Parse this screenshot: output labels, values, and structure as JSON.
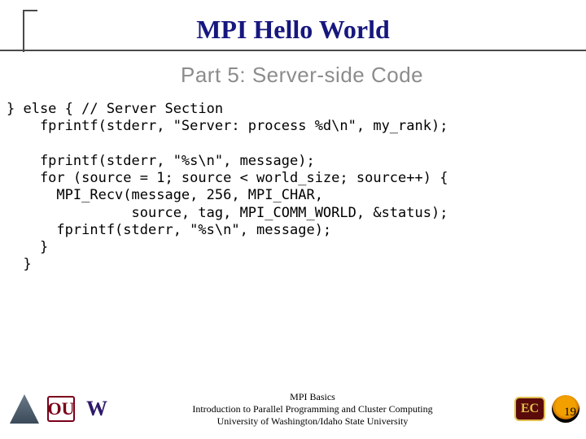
{
  "header": {
    "title": "MPI Hello World",
    "subtitle": "Part 5: Server-side Code"
  },
  "code": "} else { // Server Section\n    fprintf(stderr, \"Server: process %d\\n\", my_rank);\n\n    fprintf(stderr, \"%s\\n\", message);\n    for (source = 1; source < world_size; source++) {\n      MPI_Recv(message, 256, MPI_CHAR,\n               source, tag, MPI_COMM_WORLD, &status);\n      fprintf(stderr, \"%s\\n\", message);\n    }\n  }",
  "footer": {
    "line1": "MPI Basics",
    "line2": "Introduction to Parallel Programming and Cluster Computing",
    "line3": "University of Washington/Idaho State University"
  },
  "logos": {
    "tri": "",
    "ou": "OU",
    "w": "W",
    "ec": "EC",
    "tiger": ""
  },
  "page_number": "19"
}
